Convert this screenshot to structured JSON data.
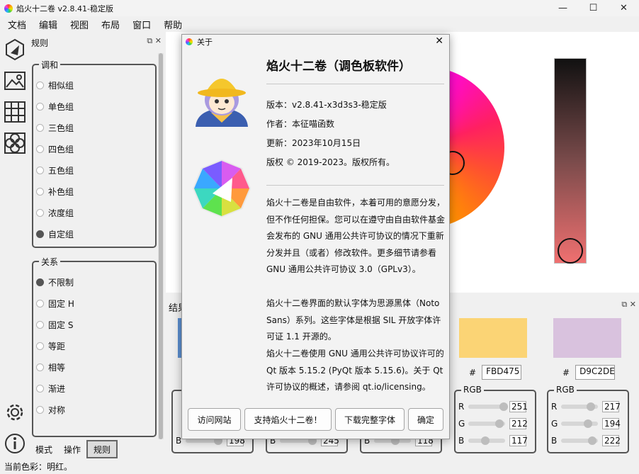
{
  "window": {
    "title": "焰火十二卷 v2.8.41-稳定版",
    "minimize": "—",
    "maximize": "☐",
    "close": "✕"
  },
  "menu": [
    "文档",
    "编辑",
    "视图",
    "布局",
    "窗口",
    "帮助"
  ],
  "toolbar_icons": [
    "wheel-icon",
    "image-icon",
    "grid-icon",
    "circles-icon"
  ],
  "rules_panel": {
    "title": "规则",
    "harmony": {
      "label": "调和",
      "options": [
        "相似组",
        "单色组",
        "三色组",
        "四色组",
        "五色组",
        "补色组",
        "浓度组",
        "自定组"
      ],
      "selected": 7
    },
    "relation": {
      "label": "关系",
      "options": [
        "不限制",
        "固定 H",
        "固定 S",
        "等距",
        "相等",
        "渐进",
        "对称"
      ],
      "selected": 0
    },
    "tabs": [
      "模式",
      "操作",
      "规则"
    ],
    "active_tab": 2
  },
  "status": {
    "text": "当前色彩：明红。"
  },
  "results": {
    "title": "结果",
    "swatches": [
      {
        "color": "#5B8FD0"
      },
      {
        "color": "#E0E0E0"
      },
      {
        "color": "#E0E0E0"
      },
      {
        "color": "#E0E0E0"
      },
      {
        "color": "#FBD475",
        "hash": "#",
        "hex": "FBD475"
      },
      {
        "color": "#D9C2DE",
        "hash": "#",
        "hex": "D9C2DE"
      }
    ],
    "rgb_boxes": [
      {
        "label": "",
        "r": "",
        "g": "",
        "b": "198"
      },
      {
        "label": "",
        "r": "",
        "g": "",
        "b": "245"
      },
      {
        "label": "",
        "r": "",
        "g": "",
        "b": "118"
      },
      {
        "label": "RGB",
        "r": "251",
        "g": "212",
        "b": "117"
      },
      {
        "label": "RGB",
        "r": "217",
        "g": "194",
        "b": "222"
      }
    ],
    "channel_labels": {
      "r": "R",
      "g": "G",
      "b": "B"
    }
  },
  "about": {
    "title": "关于",
    "heading": "焰火十二卷（调色板软件）",
    "version": "版本：v2.8.41-x3d3s3-稳定版",
    "author": "作者：本征喵函数",
    "updated": "更新：2023年10月15日",
    "copyright": "版权 © 2019-2023。版权所有。",
    "para1": "焰火十二卷是自由软件，本着可用的意愿分发，但不作任何担保。您可以在遵守由自由软件基金会发布的 GNU 通用公共许可协议的情况下重新分发并且（或者）修改软件。更多细节请参看 GNU 通用公共许可协议 3.0（GPLv3）。",
    "para2": "焰火十二卷界面的默认字体为思源黑体（Noto Sans）系列。这些字体是根据 SIL 开放字体许可证 1.1 开源的。",
    "para3": "焰火十二卷使用 GNU 通用公共许可协议许可的 Qt 版本 5.15.2 (PyQt 版本 5.15.6)。关于 Qt 许可协议的概述，请参阅 qt.io/licensing。",
    "buttons": {
      "website": "访问网站",
      "support": "支持焰火十二卷！",
      "download": "下载完整字体",
      "ok": "确定"
    }
  },
  "colors": {
    "wheel_primary": "#ff00ff",
    "accent": "#ff5030"
  }
}
